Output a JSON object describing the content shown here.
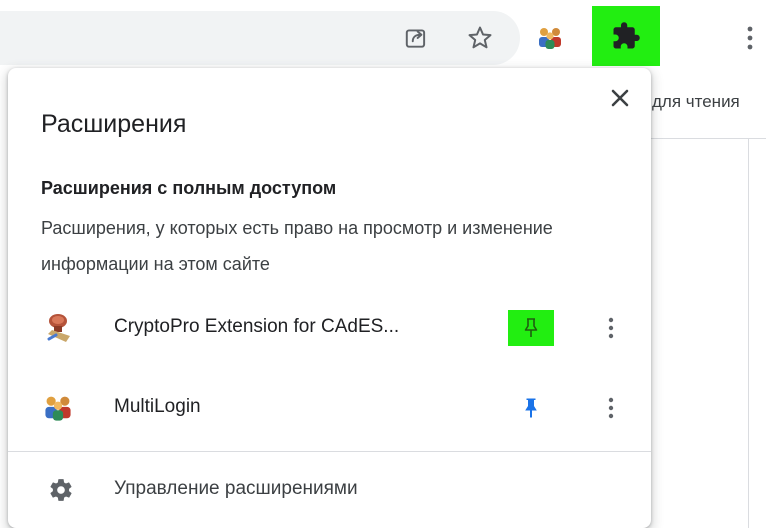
{
  "toolbar": {
    "share_icon": "share-page-icon",
    "bookmark_icon": "bookmark-star-icon",
    "pinned_extension_icon": "multilogin-people-icon",
    "extensions_icon": "puzzle-piece-icon",
    "extensions_highlight_color": "#22ee11",
    "menu_icon": "vertical-dots-icon"
  },
  "bookmarks_bar": {
    "partial_text": "для чтения"
  },
  "extensions_popup": {
    "title": "Расширения",
    "close_icon": "close-icon",
    "section_heading": "Расширения с полным доступом",
    "section_description": "Расширения, у которых есть право на просмотр и изменение информации на этом сайте",
    "extensions": [
      {
        "name": "CryptoPro Extension for CAdES...",
        "icon": "cryptopro-seal-icon",
        "pinned": false,
        "pin_highlight_color": "#22ee11"
      },
      {
        "name": "MultiLogin",
        "icon": "multilogin-people-icon",
        "pinned": true,
        "pin_color": "#1a73e8"
      }
    ],
    "manage_label": "Управление расширениями",
    "manage_icon": "gear-icon"
  }
}
